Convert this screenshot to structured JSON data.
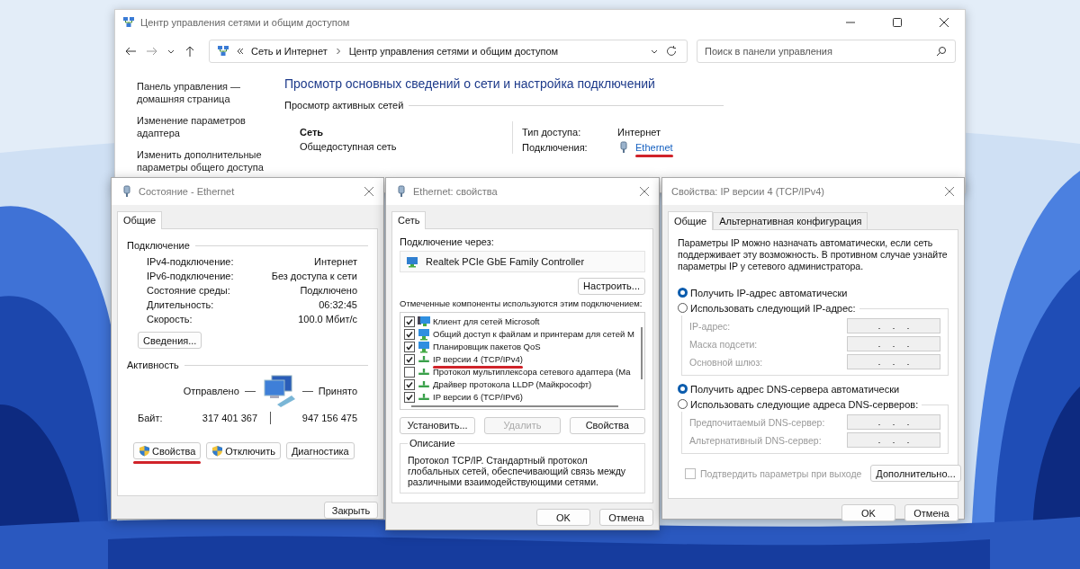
{
  "main_window": {
    "title": "Центр управления сетями и общим доступом",
    "address_segments": [
      "Сеть и Интернет",
      "Центр управления сетями и общим доступом"
    ],
    "search": {
      "placeholder": "Поиск в панели управления"
    },
    "sidebar_links": [
      "Панель управления — домашняя страница",
      "Изменение параметров адаптера",
      "Изменить дополнительные параметры общего доступа"
    ],
    "heading": "Просмотр основных сведений о сети и настройка подключений",
    "section": "Просмотр активных сетей",
    "network": {
      "name": "Сеть",
      "category": "Общедоступная сеть"
    },
    "access_type": {
      "label": "Тип доступа:",
      "value": "Интернет"
    },
    "connections": {
      "label": "Подключения:",
      "link": "Ethernet",
      "underlined": true
    }
  },
  "status_dialog": {
    "title": "Состояние - Ethernet",
    "tabs": [
      {
        "label": "Общие",
        "selected": true
      }
    ],
    "connection_group": "Подключение",
    "rows": [
      {
        "label": "IPv4-подключение:",
        "value": "Интернет"
      },
      {
        "label": "IPv6-подключение:",
        "value": "Без доступа к сети"
      },
      {
        "label": "Состояние среды:",
        "value": "Подключено"
      },
      {
        "label": "Длительность:",
        "value": "06:32:45"
      },
      {
        "label": "Скорость:",
        "value": "100.0 Мбит/с"
      }
    ],
    "details_button": "Сведения...",
    "activity_group": "Активность",
    "sent_label": "Отправлено",
    "received_label": "Принято",
    "bytes_label": "Байт:",
    "bytes_sent": "317 401 367",
    "bytes_received": "947 156 475",
    "buttons": [
      {
        "label": "Свойства",
        "shield": true,
        "underlined": true
      },
      {
        "label": "Отключить",
        "shield": true,
        "underlined": false
      },
      {
        "label": "Диагностика",
        "shield": false,
        "underlined": false
      }
    ],
    "close_button": "Закрыть"
  },
  "properties_dialog": {
    "title": "Ethernet: свойства",
    "tabs": [
      {
        "label": "Сеть",
        "selected": true
      }
    ],
    "connect_using_label": "Подключение через:",
    "adapter": "Realtek PCIe GbE Family Controller",
    "configure_button": "Настроить...",
    "components_label": "Отмеченные компоненты используются этим подключением:",
    "components": [
      {
        "label": "Клиент для сетей Microsoft",
        "checked": true,
        "kind": "client",
        "underlined": false
      },
      {
        "label": "Общий доступ к файлам и принтерам для сетей M",
        "checked": true,
        "kind": "service",
        "underlined": false
      },
      {
        "label": "Планировщик пакетов QoS",
        "checked": true,
        "kind": "service",
        "underlined": false
      },
      {
        "label": "IP версии 4 (TCP/IPv4)",
        "checked": true,
        "kind": "protocol",
        "underlined": true
      },
      {
        "label": "Протокол мультиплексора сетевого адаптера (Ма",
        "checked": false,
        "kind": "protocol",
        "underlined": false
      },
      {
        "label": "Драйвер протокола LLDP (Майкрософт)",
        "checked": true,
        "kind": "protocol",
        "underlined": false
      },
      {
        "label": "IP версии 6 (TCP/IPv6)",
        "checked": true,
        "kind": "protocol",
        "underlined": false
      }
    ],
    "buttons": [
      {
        "label": "Установить...",
        "disabled": false
      },
      {
        "label": "Удалить",
        "disabled": true
      },
      {
        "label": "Свойства",
        "disabled": false
      }
    ],
    "description_group": "Описание",
    "description": "Протокол TCP/IP. Стандартный протокол глобальных сетей, обеспечивающий связь между различными взаимодействующими сетями.",
    "ok_button": "OK",
    "cancel_button": "Отмена"
  },
  "ipv4_dialog": {
    "title": "Свойства: IP версии 4 (TCP/IPv4)",
    "tabs": [
      {
        "label": "Общие",
        "selected": true
      },
      {
        "label": "Альтернативная конфигурация",
        "selected": false
      }
    ],
    "intro": "Параметры IP можно назначать автоматически, если сеть поддерживает эту возможность. В противном случае узнайте параметры IP у сетевого администратора.",
    "ip_options": [
      {
        "label": "Получить IP-адрес автоматически",
        "selected": true
      },
      {
        "label": "Использовать следующий IP-адрес:",
        "selected": false
      }
    ],
    "ip_fields": [
      {
        "label": "IP-адрес:",
        "disabled": true
      },
      {
        "label": "Маска подсети:",
        "disabled": true
      },
      {
        "label": "Основной шлюз:",
        "disabled": true
      }
    ],
    "dns_options": [
      {
        "label": "Получить адрес DNS-сервера автоматически",
        "selected": true
      },
      {
        "label": "Использовать следующие адреса DNS-серверов:",
        "selected": false
      }
    ],
    "dns_fields": [
      {
        "label": "Предпочитаемый DNS-сервер:",
        "disabled": true
      },
      {
        "label": "Альтернативный DNS-сервер:",
        "disabled": true
      }
    ],
    "validate": {
      "label": "Подтвердить параметры при выходе",
      "checked": false,
      "disabled": true
    },
    "advanced_button": "Дополнительно...",
    "ok_button": "OK",
    "cancel_button": "Отмена"
  }
}
